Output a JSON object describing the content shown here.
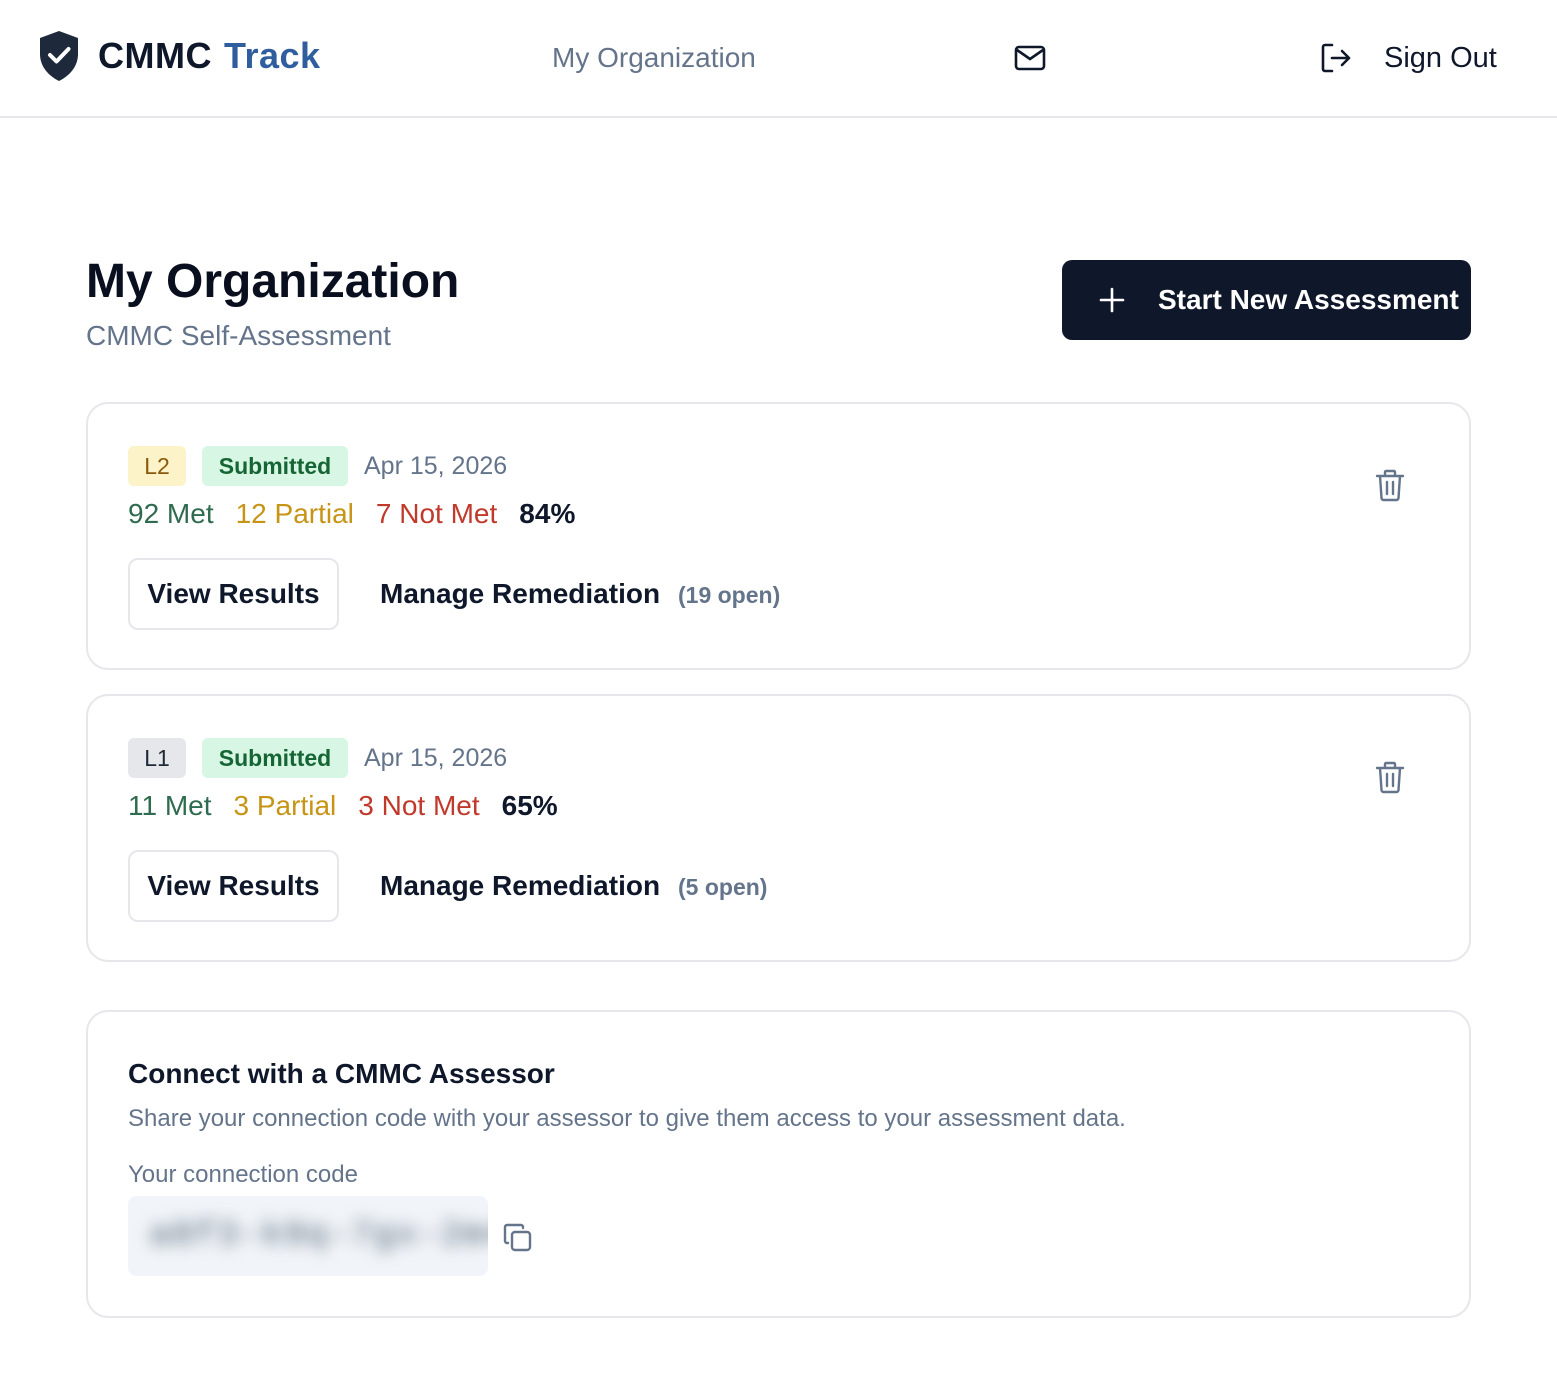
{
  "header": {
    "brand_primary": "CMMC",
    "brand_secondary": "Track",
    "nav_link": "My Organization",
    "sign_out": "Sign Out"
  },
  "page": {
    "title": "My Organization",
    "subtitle": "CMMC Self-Assessment",
    "new_assessment_label": "Start New Assessment"
  },
  "assessments": [
    {
      "level": "L2",
      "status": "Submitted",
      "date": "Apr 15, 2026",
      "met": "92 Met",
      "partial": "12 Partial",
      "not_met": "7 Not Met",
      "percent": "84%",
      "view_results_label": "View Results",
      "remediation_label": "Manage Remediation",
      "open_count": "(19 open)"
    },
    {
      "level": "L1",
      "status": "Submitted",
      "date": "Apr 15, 2026",
      "met": "11 Met",
      "partial": "3 Partial",
      "not_met": "3 Not Met",
      "percent": "65%",
      "view_results_label": "View Results",
      "remediation_label": "Manage Remediation",
      "open_count": "(5 open)"
    }
  ],
  "connect": {
    "title": "Connect with a CMMC Assessor",
    "description": "Share your connection code with your assessor to give them access to your assessment data.",
    "code_label": "Your connection code",
    "code_value": "a8f3-k9q-7gx-2m4"
  },
  "icons": {
    "brand": "shield-check-icon",
    "mail": "mail-icon",
    "sign_out": "log-out-icon",
    "add": "plus-icon",
    "delete": "trash-icon",
    "copy": "copy-icon"
  },
  "colors": {
    "primary": "#0f172a",
    "brand_accent": "#2f5d9e",
    "met": "#2f6b4f",
    "partial": "#c79416",
    "not_met": "#c0392b",
    "submitted_bg": "#d7f6e4",
    "l2_bg": "#fdf3c8"
  }
}
